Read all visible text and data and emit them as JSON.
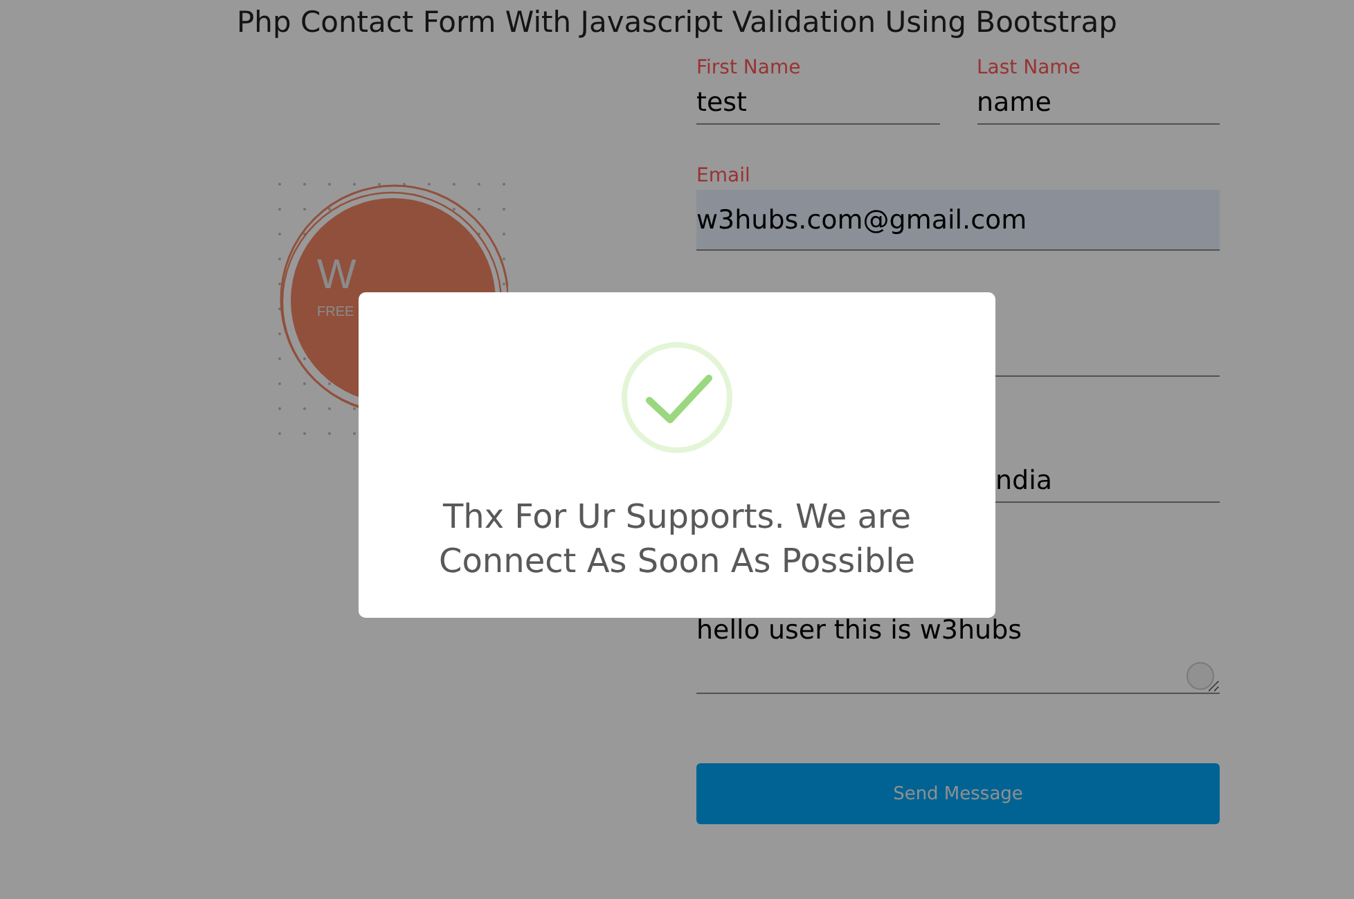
{
  "title": "Php Contact Form With Javascript Validation Using Bootstrap",
  "logo": {
    "letter": "W",
    "tagline": "FREE"
  },
  "form": {
    "rows": [
      {
        "fields": [
          {
            "kind": "text",
            "label": "First Name",
            "value": "test",
            "autofilled": false
          },
          {
            "kind": "text",
            "label": "Last Name",
            "value": "name",
            "autofilled": false
          }
        ]
      },
      {
        "fields": [
          {
            "kind": "text",
            "label": "Email",
            "value": "w3hubs.com@gmail.com",
            "autofilled": true
          }
        ]
      },
      {
        "fields": [
          {
            "kind": "blank",
            "autofilled": false
          }
        ]
      },
      {
        "fields": [
          {
            "kind": "covered",
            "value": "ndia",
            "autofilled": false
          }
        ]
      },
      {
        "fields": [
          {
            "kind": "message",
            "value": "hello user this is w3hubs",
            "autofilled": false
          }
        ]
      }
    ],
    "submit": "Send Message"
  },
  "dialog": {
    "kind": "success",
    "message": "Thx For Ur Supports. We are Connect As Soon As Possible"
  }
}
